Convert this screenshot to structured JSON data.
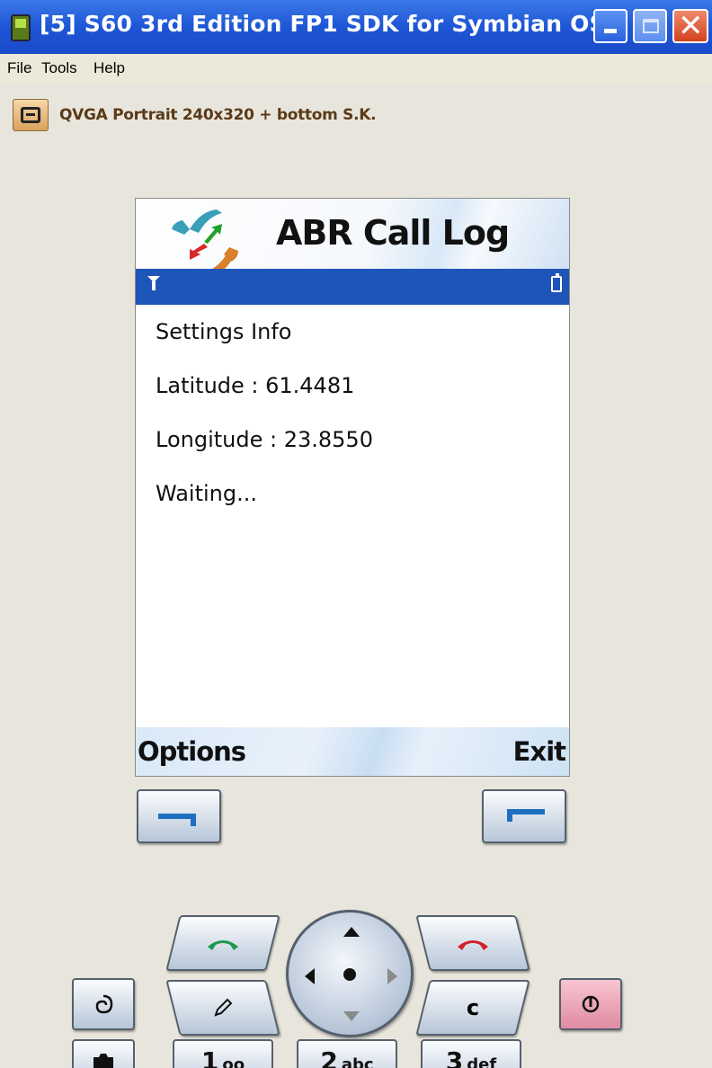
{
  "window": {
    "title": "[5] S60 3rd Edition FP1 SDK for Symbian OS - ...",
    "min_icon": "minimize-icon",
    "max_icon": "maximize-icon",
    "close_icon": "close-icon"
  },
  "menu": {
    "file": "File",
    "tools": "Tools",
    "help": "Help"
  },
  "device_layout": {
    "label": "QVGA  Portrait  240x320  + bottom S.K."
  },
  "app": {
    "title": "ABR Call Log",
    "lines": {
      "settings": "Settings Info",
      "latitude": "Latitude : 61.4481",
      "longitude": "Longitude : 23.8550",
      "status": "Waiting..."
    },
    "softkeys": {
      "left": "Options",
      "right": "Exit"
    }
  },
  "colors": {
    "titlebar": "#1e56d6",
    "status_bar": "#1e55b8",
    "softkey_accent": "#1e6fc0",
    "call_green": "#1a9a4a",
    "end_red": "#d0202a",
    "power_pink": "#e08ba2"
  },
  "keypad": {
    "clear": "c",
    "key1": "1",
    "key1_sub": "oo",
    "key2": "2",
    "key2_sub": "abc",
    "key3": "3",
    "key3_sub": "def"
  }
}
